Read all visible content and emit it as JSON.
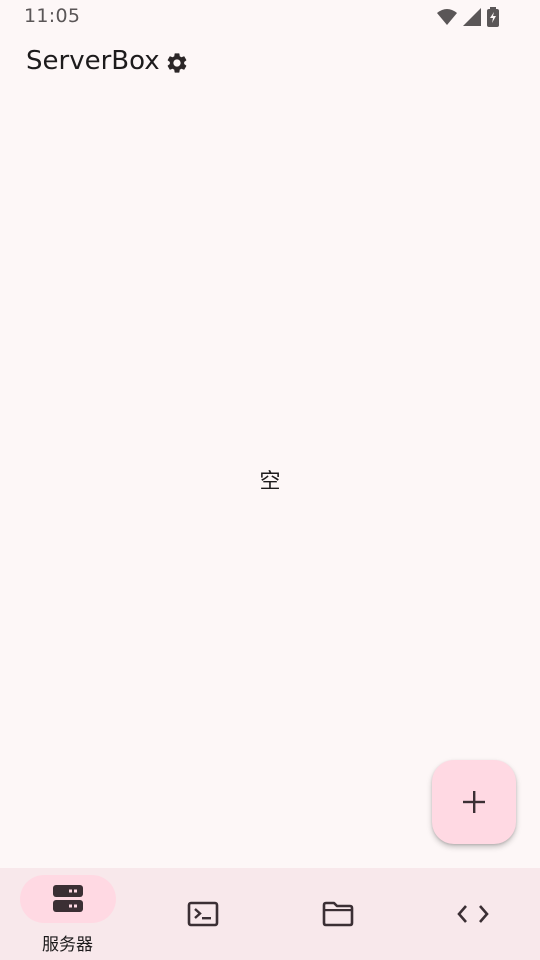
{
  "status_bar": {
    "time": "11:05",
    "icons": [
      "wifi-icon",
      "cellular-signal-icon",
      "battery-charging-icon"
    ]
  },
  "app_bar": {
    "title": "ServerBox",
    "settings_icon": "gear-icon"
  },
  "main": {
    "empty_text": "空"
  },
  "fab": {
    "icon": "plus-icon"
  },
  "bottom_nav": {
    "items": [
      {
        "icon": "server-icon",
        "label": "服务器",
        "selected": true
      },
      {
        "icon": "terminal-icon",
        "label": "",
        "selected": false
      },
      {
        "icon": "folder-icon",
        "label": "",
        "selected": false
      },
      {
        "icon": "code-icon",
        "label": "",
        "selected": false
      }
    ]
  },
  "colors": {
    "background": "#fdf7f7",
    "nav_background": "#f8e8eb",
    "accent_container": "#ffd9e3",
    "on_surface": "#1d1b1c",
    "icon_dark": "#3b2f34"
  }
}
